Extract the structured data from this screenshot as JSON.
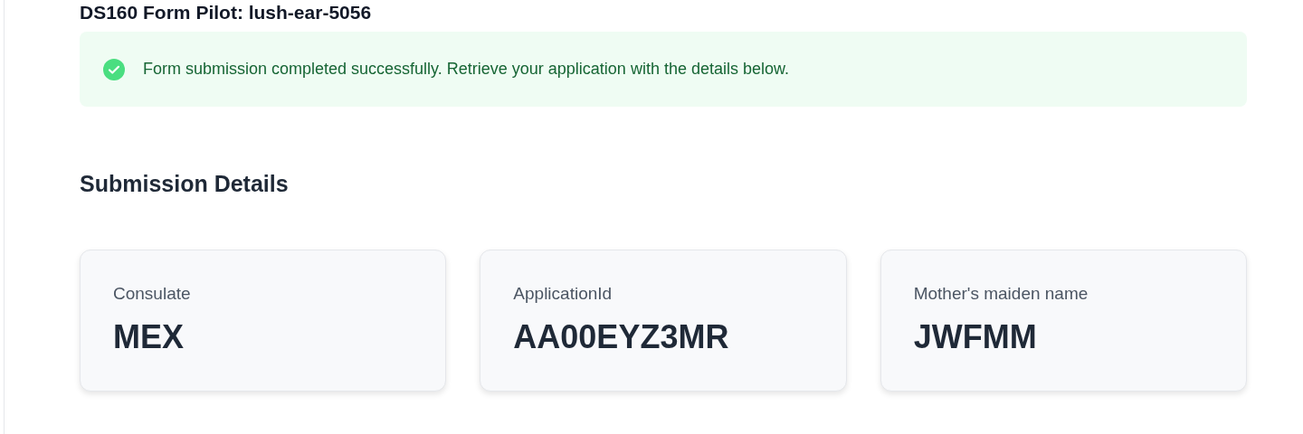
{
  "title": "DS160 Form Pilot: lush-ear-5056",
  "alert": {
    "kind": "success",
    "message": "Form submission completed successfully. Retrieve your application with the details below."
  },
  "section_title": "Submission Details",
  "details": [
    {
      "label": "Consulate",
      "value": "MEX"
    },
    {
      "label": "ApplicationId",
      "value": "AA00EYZ3MR"
    },
    {
      "label": "Mother's maiden name",
      "value": "JWFMM"
    }
  ]
}
